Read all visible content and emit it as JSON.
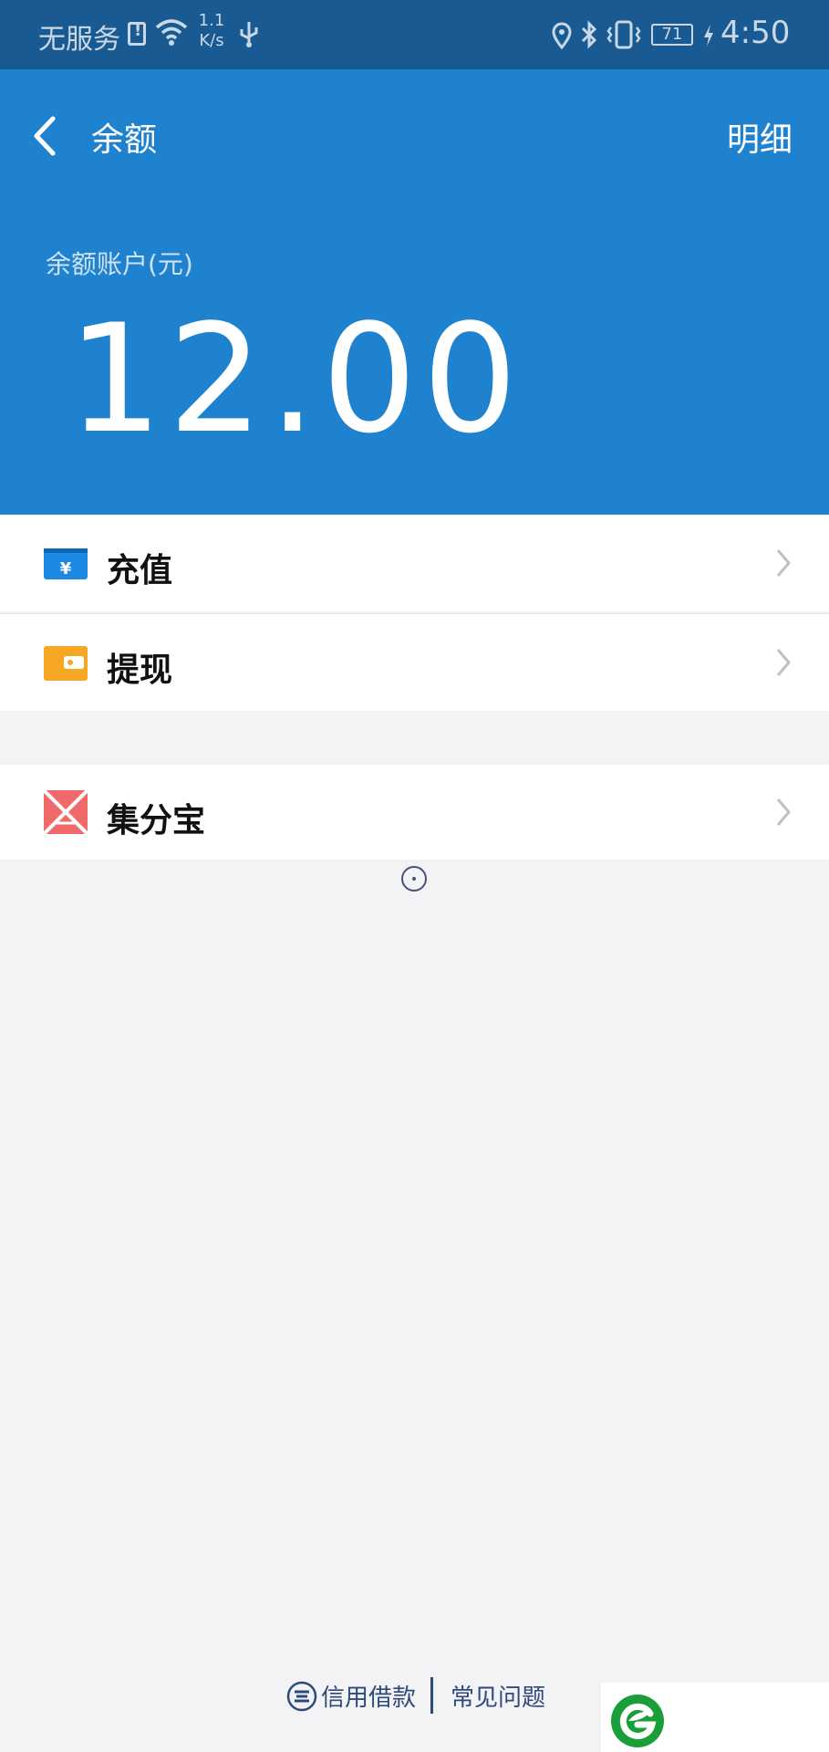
{
  "status_bar": {
    "carrier": "无服务",
    "net_speed_top": "1.1",
    "net_speed_bottom": "K/s",
    "battery": "71",
    "time": "4:50"
  },
  "header": {
    "title": "余额",
    "detail_link": "明细",
    "balance_label": "余额账户(元)",
    "balance_amount": "12.00",
    "color": "#1e82cf"
  },
  "menu": {
    "items": [
      {
        "label": "充值",
        "icon": "recharge-icon",
        "icon_color": "#1e88e5"
      },
      {
        "label": "提现",
        "icon": "withdraw-icon",
        "icon_color": "#f5a623"
      },
      {
        "label": "集分宝",
        "icon": "jifenbao-icon",
        "icon_color": "#f06a6a"
      }
    ]
  },
  "footer": {
    "credit_link": "信用借款",
    "faq_link": "常见问题"
  }
}
